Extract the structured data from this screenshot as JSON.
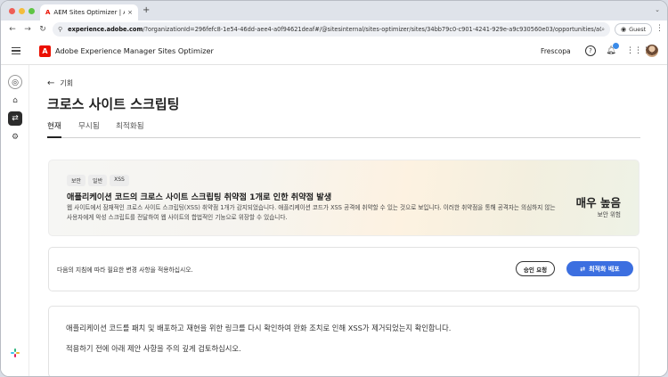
{
  "browser": {
    "tab_favicon": "A",
    "tab_title": "AEM Sites Optimizer | Adobe",
    "tab_close": "×",
    "new_tab": "+",
    "url_host": "experience.adobe.com",
    "url_path": "/?organizationId=296fefc8-1e54-46dd-aee4-a0f94621deaf#/@sitesinternal/sites-optimizer/sites/34bb79c0-c901-4241-929e-a9c930560e03/opportunities/a0739bd...",
    "guest_label": "Guest"
  },
  "app": {
    "name": "Adobe Experience Manager Sites Optimizer",
    "org": "Frescopa",
    "logo_letter": "A"
  },
  "page": {
    "back_label": "기회",
    "title": "크로스 사이트 스크립팅",
    "tabs": [
      {
        "label": "현재",
        "active": true
      },
      {
        "label": "무시됨",
        "active": false
      },
      {
        "label": "최적화됨",
        "active": false
      }
    ]
  },
  "issue": {
    "tags": [
      "보안",
      "일반",
      "XSS"
    ],
    "title": "애플리케이션 코드의 크로스 사이트 스크립팅 취약점 1개로 인한 취약점 발생",
    "description": "웹 사이트에서 잠재적인 크로스 사이트 스크립팅(XSS) 취약점 1개가 감지되었습니다. 애플리케이션 코드가 XSS 공격에 취약할 수 있는 것으로 보입니다. 이러한 취약점을 통해 공격자는 의심하지 않는 사용자에게 악성 스크립트를 전달하여 웹 사이트의 합법적인 기능으로 위장할 수 있습니다.",
    "severity": "매우 높음",
    "severity_label": "보안 위험"
  },
  "action": {
    "text": "다음의 지침에 따라 필요한 변경 사항을 적용하십시오.",
    "approve_label": "승인 요청",
    "deploy_label": "최적화 배포"
  },
  "info": {
    "line1": "애플리케이션 코드를 패치 및 배포하고 재현을 위한 링크를 다시 확인하여 완화 조치로 인해 XSS가 제거되었는지 확인합니다.",
    "line2": "적용하기 전에 아래 제안 사항을 주의 깊게 검토하십시오."
  },
  "icons": {
    "menu": "hamburger-icon",
    "help": "help-icon",
    "notifications": "bell-icon",
    "apps": "app-grid-icon",
    "back": "arrow-left-icon",
    "deploy": "sparkle-icon"
  },
  "colors": {
    "accent": "#3c6fe0",
    "adobe_red": "#eb1000",
    "notification_badge": "#3b8be8"
  }
}
